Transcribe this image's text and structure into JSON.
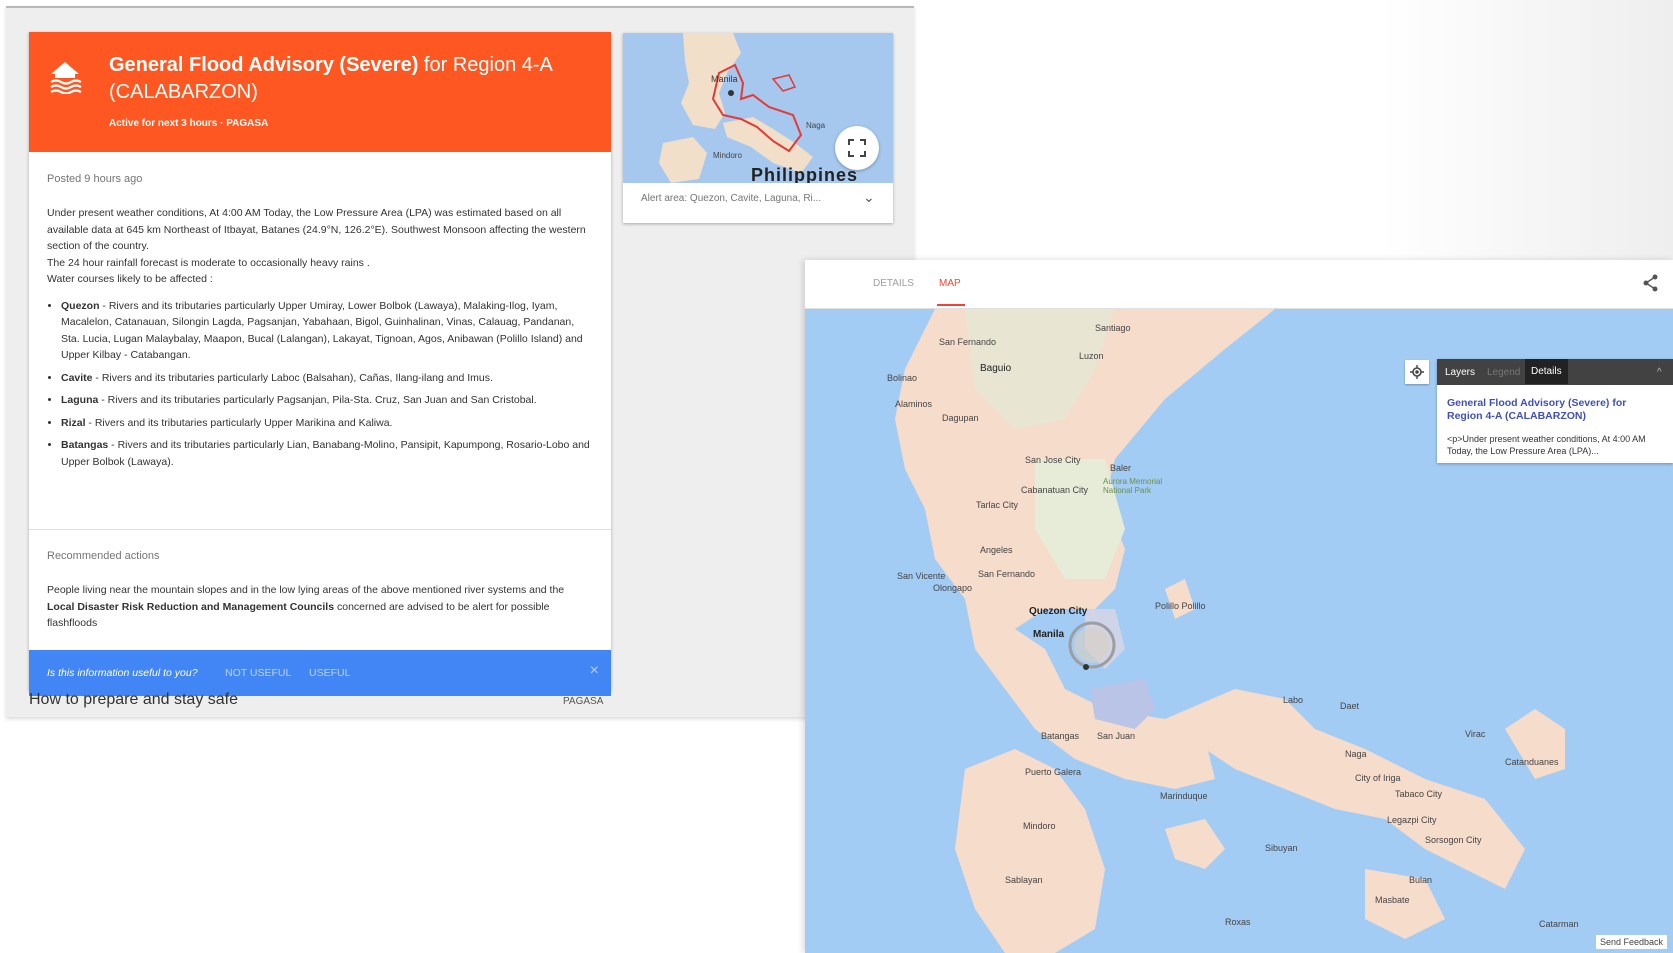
{
  "advisory": {
    "title_bold": "General Flood Advisory (Severe)",
    "title_rest": "for Region 4-A (CALABARZON)",
    "subtitle": "Active for next 3 hours · PAGASA",
    "posted": "Posted 9 hours ago",
    "body_p1": "Under present weather conditions, At 4:00 AM Today, the Low Pressure Area (LPA) was estimated based on all available data at 645 km Northeast of Itbayat, Batanes (24.9°N, 126.2°E). Southwest Monsoon affecting the western section of the country.",
    "body_p2": "The 24 hour rainfall forecast is moderate to occasionally heavy rains .",
    "body_p3": "Water courses likely to be affected :",
    "rivers": [
      {
        "name": "Quezon",
        "text": " - Rivers and its tributaries particularly Upper Umiray, Lower Bolbok (Lawaya), Malaking-Ilog, Iyam, Macalelon, Catanauan, Silongin Lagda, Pagsanjan, Yabahaan, Bigol, Guinhalinan, Vinas, Calauag, Pandanan, Sta. Lucia, Lugan Malaybalay, Maapon, Bucal (Lalangan), Lakayat, Tignoan, Agos, Anibawan (Polillo Island) and Upper Kilbay - Catabangan."
      },
      {
        "name": "Cavite",
        "text": " - Rivers and its tributaries particularly Laboc (Balsahan), Cañas, Ilang-ilang and Imus."
      },
      {
        "name": "Laguna",
        "text": " - Rivers and its tributaries particularly Pagsanjan, Pila-Sta. Cruz, San Juan and San Cristobal."
      },
      {
        "name": "Rizal",
        "text": " - Rivers and its tributaries particularly Upper Marikina and Kaliwa."
      },
      {
        "name": "Batangas",
        "text": " - Rivers and its tributaries particularly Lian, Banabang-Molino, Pansipit, Kapumpong, Rosario-Lobo and Upper Bolbok (Lawaya)."
      }
    ],
    "rec_title": "Recommended actions",
    "rec_pre": "People living near the mountain slopes and in the low lying areas of the above mentioned river systems and the ",
    "rec_bold": "Local Disaster Risk Reduction and Management Councils",
    "rec_post": " concerned are advised to be alert for possible flashfloods",
    "feedback_q": "Is this information useful to you?",
    "feedback_not": "NOT USEFUL",
    "feedback_yes": "USEFUL",
    "feedback_close": "×",
    "prepare": "How to prepare and stay safe",
    "prepare_src": "PAGASA",
    "header_color": "#ff5722",
    "feedback_color": "#4285f4"
  },
  "mini_map": {
    "country_label": "Philippines",
    "manila_label": "Manila",
    "naga_label": "Naga",
    "mindoro_label": "Mindoro",
    "expand_icon": "fullscreen-icon",
    "alert_area": "Alert area: Quezon, Cavite, Laguna, Ri...",
    "chevron": "⌄"
  },
  "map_view": {
    "tab_details": "DETAILS",
    "tab_map": "MAP",
    "share_icon": "share-icon",
    "layers_tab": "Layers",
    "legend_tab": "Legend",
    "details_tab": "Details",
    "collapse": "^",
    "layer_title": "General Flood Advisory (Severe) for Region 4-A (CALABARZON)",
    "layer_desc": "<p>Under present weather conditions, At 4:00 AM Today, the Low Pressure Area (LPA)...",
    "send_feedback": "Send Feedback",
    "labels": {
      "san_fernando_n": "San Fernando",
      "baguio": "Baguio",
      "santiago": "Santiago",
      "dagupan": "Dagupan",
      "alaminos": "Alaminos",
      "bolinao": "Bolinao",
      "san_jose_city": "San Jose City",
      "cabanatuan": "Cabanatuan City",
      "tarlac": "Tarlac City",
      "aurora": "Aurora Memorial National Park",
      "baler": "Baler",
      "angeles": "Angeles",
      "san_fernando": "San Fernando",
      "olongapo": "Olongapo",
      "quezon_city": "Quezon City",
      "manila": "Manila",
      "polillo": "Polillo Polillo",
      "batangas": "Batangas",
      "san_juan": "San Juan",
      "puerto_galera": "Puerto Galera",
      "mindoro": "Mindoro",
      "sablayan": "Sablayan",
      "naga": "Naga",
      "labo": "Labo",
      "daet": "Daet",
      "iriga": "City of Iriga",
      "tabaco": "Tabaco City",
      "legazpi": "Legazpi City",
      "sorsogon": "Sorsogon City",
      "marinduque": "Marinduque",
      "sibuyan": "Sibuyan",
      "masbate": "Masbate",
      "catanduanes": "Catanduanes",
      "virac": "Virac",
      "bulan": "Bulan",
      "catarman": "Catarman",
      "roxas": "Roxas",
      "luzon": "Luzon",
      "san_vicente": "San Vicente"
    }
  }
}
